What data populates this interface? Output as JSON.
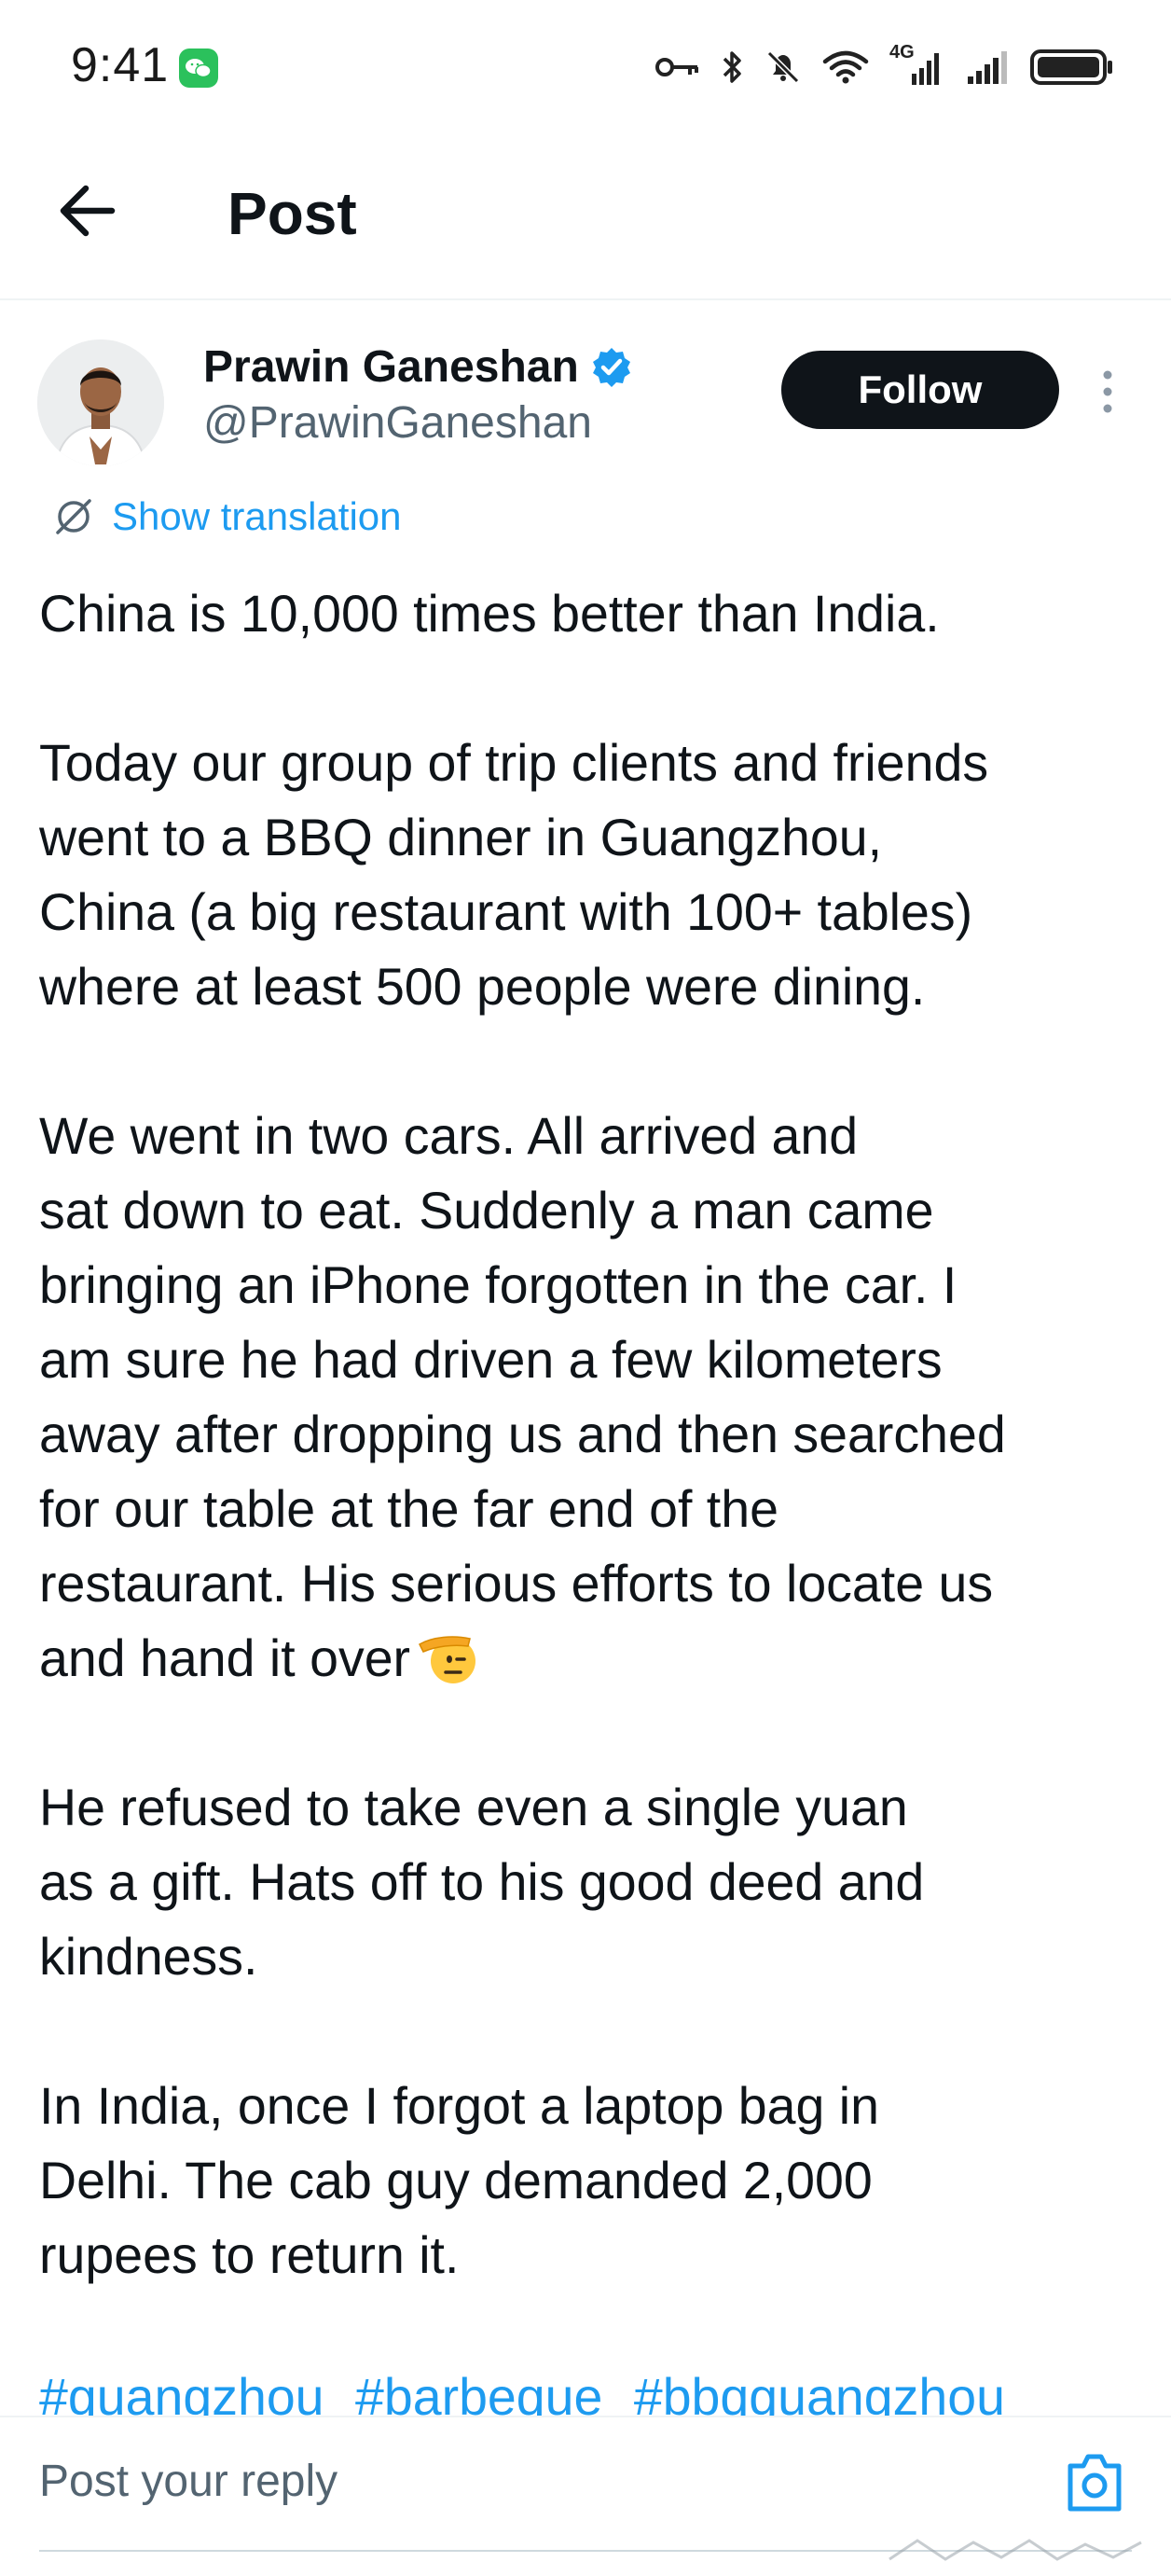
{
  "status_bar": {
    "time": "9:41",
    "network_label": "4G"
  },
  "header": {
    "title": "Post"
  },
  "post": {
    "author": {
      "name": "Prawin Ganeshan",
      "handle": "@PrawinGaneshan",
      "verified": true
    },
    "follow_label": "Follow",
    "translation_label": "Show translation",
    "paragraphs": [
      [
        "China is 10,000 times better than India."
      ],
      [
        "Today our group of trip clients and friends",
        "went to a BBQ dinner in Guangzhou,",
        "China (a big restaurant with 100+ tables)",
        "where at least 500 people were dining."
      ],
      [
        "We went in two cars. All arrived and",
        "sat down to eat. Suddenly a man came",
        "bringing an iPhone forgotten in the car. I",
        "am sure he had driven a few kilometers",
        "away after dropping us and then searched",
        "for our table at the far end of the",
        "restaurant. His serious efforts to locate us",
        "and hand it over"
      ],
      [
        "He refused to take even a single yuan",
        "as a gift. Hats off to his good deed and",
        "kindness."
      ],
      [
        "In India, once I forgot a laptop bag in",
        "Delhi. The cab guy demanded 2,000",
        "rupees to return it."
      ]
    ],
    "hashtags": [
      "#guangzhou",
      "#barbeque",
      "#bbqguangzhou"
    ]
  },
  "reply": {
    "placeholder": "Post your reply"
  },
  "colors": {
    "accent": "#1d9bf0",
    "text": "#0f1419",
    "secondary_text": "#536471",
    "follow_bg": "#0f1419",
    "wechat_green": "#2bc15c"
  },
  "icons": {
    "back": "arrow-left-icon",
    "verified": "verified-badge-icon",
    "more": "more-vertical-icon",
    "translate": "translate-icon",
    "camera": "camera-icon",
    "salute_emoji": "saluting-face-emoji"
  }
}
